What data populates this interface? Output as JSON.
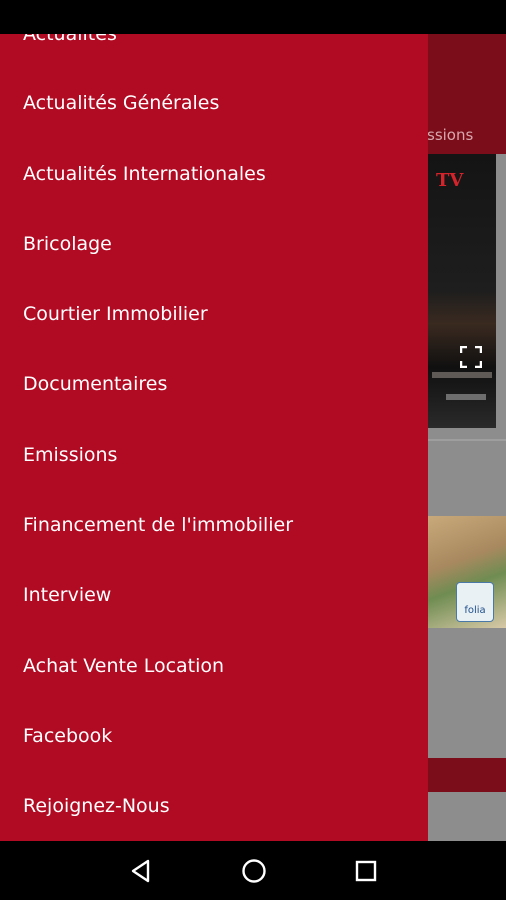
{
  "background_app": {
    "visible_tab_fragment": "ssions",
    "video_logo": "TV",
    "card_logo": "folia"
  },
  "drawer": {
    "items": [
      {
        "label": "Actualités"
      },
      {
        "label": "Actualités Générales"
      },
      {
        "label": "Actualités Internationales"
      },
      {
        "label": "Bricolage"
      },
      {
        "label": "Courtier Immobilier"
      },
      {
        "label": "Documentaires"
      },
      {
        "label": "Emissions"
      },
      {
        "label": "Financement de l'immobilier"
      },
      {
        "label": "Interview"
      },
      {
        "label": "Achat Vente Location"
      },
      {
        "label": "Facebook"
      },
      {
        "label": "Rejoignez-Nous"
      }
    ]
  },
  "nav_bar": {
    "back_icon": "back-triangle-icon",
    "home_icon": "home-circle-icon",
    "recents_icon": "recents-square-icon"
  },
  "colors": {
    "drawer_bg": "#b10a23",
    "toolbar": "#7b0c19",
    "scrim_bg": "#8d8d8d"
  }
}
